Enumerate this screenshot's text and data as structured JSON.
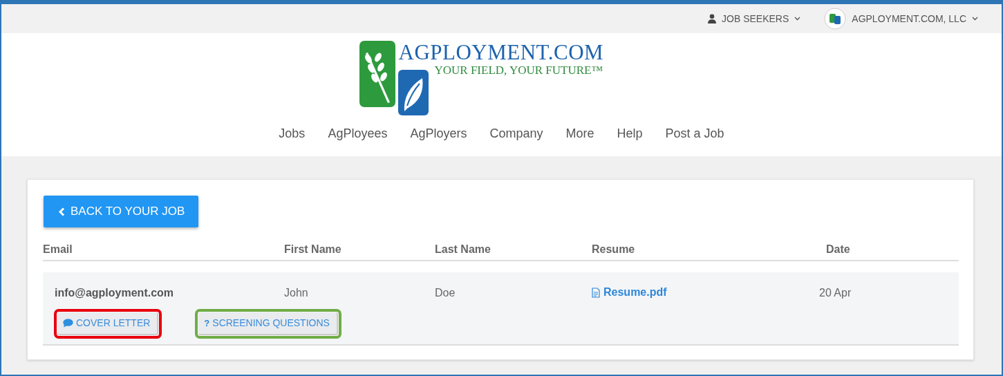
{
  "top_bar": {
    "menus": [
      {
        "label": "JOB SEEKERS",
        "kind": "user"
      },
      {
        "label": "AGPLOYMENT.COM, LLC",
        "kind": "company"
      }
    ]
  },
  "logo": {
    "name": "AGPLOYMENT.COM",
    "tagline": "YOUR FIELD, YOUR FUTURE™"
  },
  "nav": [
    "Jobs",
    "AgPloyees",
    "AgPloyers",
    "Company",
    "More",
    "Help",
    "Post a Job"
  ],
  "back_button": "BACK TO YOUR JOB",
  "table": {
    "columns": [
      "Email",
      "First Name",
      "Last Name",
      "Resume",
      "Date"
    ],
    "rows": [
      {
        "email": "info@agployment.com",
        "first_name": "John",
        "last_name": "Doe",
        "resume": "Resume.pdf",
        "date": "20 Apr",
        "actions": [
          {
            "label": "COVER LETTER",
            "kind": "comment",
            "color": "#e8000e"
          },
          {
            "label": "SCREENING QUESTIONS",
            "kind": "question",
            "icon_text": "?",
            "color": "#70ad47"
          }
        ]
      }
    ]
  }
}
